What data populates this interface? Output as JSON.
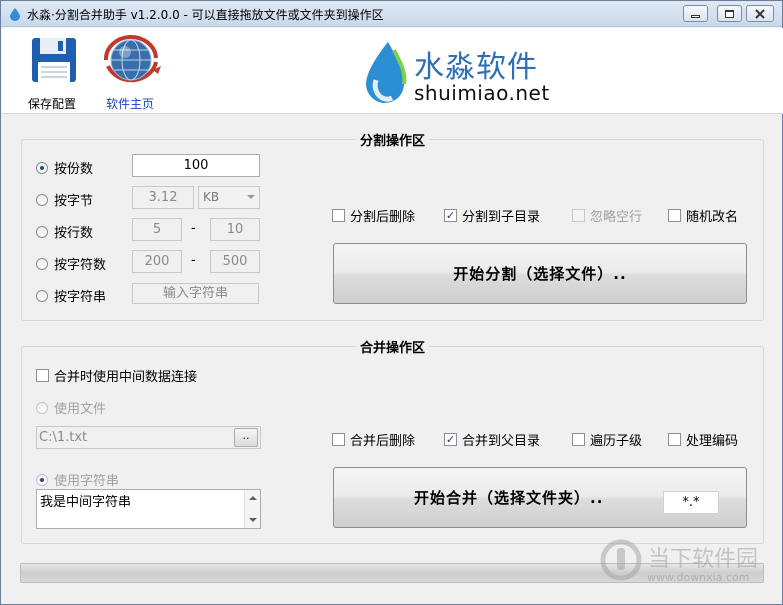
{
  "window": {
    "title": "水淼·分割合并助手 v1.2.0.0 - 可以直接拖放文件或文件夹到操作区"
  },
  "toolbar": {
    "save_label": "保存配置",
    "home_label": "软件主页"
  },
  "logo": {
    "cn": "水淼软件",
    "en": "shuimiao.net"
  },
  "split": {
    "title": "分割操作区",
    "modes": [
      {
        "label": "按份数",
        "selected": true
      },
      {
        "label": "按字节",
        "selected": false
      },
      {
        "label": "按行数",
        "selected": false
      },
      {
        "label": "按字符数",
        "selected": false
      },
      {
        "label": "按字符串",
        "selected": false
      }
    ],
    "parts_value": "100",
    "bytes_value": "3.12",
    "bytes_unit": "KB",
    "lines_from": "5",
    "lines_to": "10",
    "chars_from": "200",
    "chars_to": "500",
    "dash": "-",
    "string_placeholder": "输入字符串",
    "options": [
      {
        "label": "分割后删除",
        "checked": false,
        "disabled": false
      },
      {
        "label": "分割到子目录",
        "checked": true,
        "disabled": false
      },
      {
        "label": "忽略空行",
        "checked": false,
        "disabled": true
      },
      {
        "label": "随机改名",
        "checked": false,
        "disabled": false
      }
    ],
    "start_label": "开始分割（选择文件）.."
  },
  "merge": {
    "title": "合并操作区",
    "use_intermediate_label": "合并时使用中间数据连接",
    "use_file_label": "使用文件",
    "file_path": "C:\\1.txt",
    "browse_label": "..",
    "use_string_label": "使用字符串",
    "string_value": "我是中间字符串",
    "options": [
      {
        "label": "合并后删除",
        "checked": false
      },
      {
        "label": "合并到父目录",
        "checked": true
      },
      {
        "label": "遍历子级",
        "checked": false
      },
      {
        "label": "处理编码",
        "checked": false
      }
    ],
    "start_label": "开始合并（选择文件夹）..",
    "filter": "*.*"
  },
  "progress": {
    "value": 0
  },
  "watermark": {
    "cn": "当下软件园",
    "en": "www.downxia.com"
  }
}
